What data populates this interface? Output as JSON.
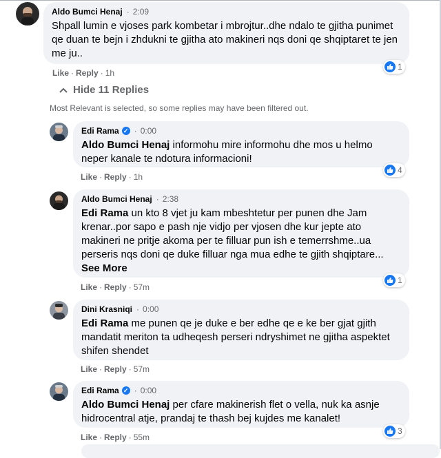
{
  "comments": [
    {
      "author": "Aldo Bumci Henaj",
      "verified": false,
      "time": "2:09",
      "mention": "",
      "text": "Shpall lumin e vjoses park kombetar i mbrojtur..dhe ndalo te gjitha punimet qe duan te bejn i zhdukni te gjitha ato makineri nqs doni qe shqiptaret te jen me ju..",
      "see_more": "",
      "like": "Like",
      "reply": "Reply",
      "ago": "1h",
      "reactions": "1"
    },
    {
      "author": "Edi Rama",
      "verified": true,
      "time": "0:00",
      "mention": "Aldo Bumci Henaj",
      "text": " informohu mire informohu dhe mos u helmo neper kanale te ndotura informacioni!",
      "see_more": "",
      "like": "Like",
      "reply": "Reply",
      "ago": "1h",
      "reactions": "4"
    },
    {
      "author": "Aldo Bumci Henaj",
      "verified": false,
      "time": "2:38",
      "mention": "Edi Rama",
      "text": " un kto 8 vjet ju kam mbeshtetur per punen dhe Jam krenar..por sapo e pash nje vidjo per vjosen dhe kur jepte ato makineri ne pritje akoma per te filluar pun ish e temerrshme..ua perseris nqs doni qe duke filluar nga mua edhe te gjith shqiptare...",
      "see_more": " See More",
      "like": "Like",
      "reply": "Reply",
      "ago": "57m",
      "reactions": "1"
    },
    {
      "author": "Dini Krasniqi",
      "verified": false,
      "time": "0:00",
      "mention": "Edi Rama",
      "text": " me punen qe je duke e ber edhe qe e ke ber gjat gjith mandatit meriton ta udheqesh perseri ndryshimet ne gjitha aspektet shifen shendet",
      "see_more": "",
      "like": "Like",
      "reply": "Reply",
      "ago": "57m",
      "reactions": ""
    },
    {
      "author": "Edi Rama",
      "verified": true,
      "time": "0:00",
      "mention": "Aldo Bumci Henaj",
      "text": " per cfare makinerish flet o vella, nuk ka asnje hidrocentral atje, prandaj te thash bej kujdes me kanalet!",
      "see_more": "",
      "like": "Like",
      "reply": "Reply",
      "ago": "55m",
      "reactions": "3"
    }
  ],
  "hide_replies": "Hide 11 Replies",
  "filter_notice": "Most Relevant is selected, so some replies may have been filtered out.",
  "colors": {
    "bubble": "#f0f2f5",
    "meta": "#65676b",
    "like_blue": "#1877f2"
  }
}
